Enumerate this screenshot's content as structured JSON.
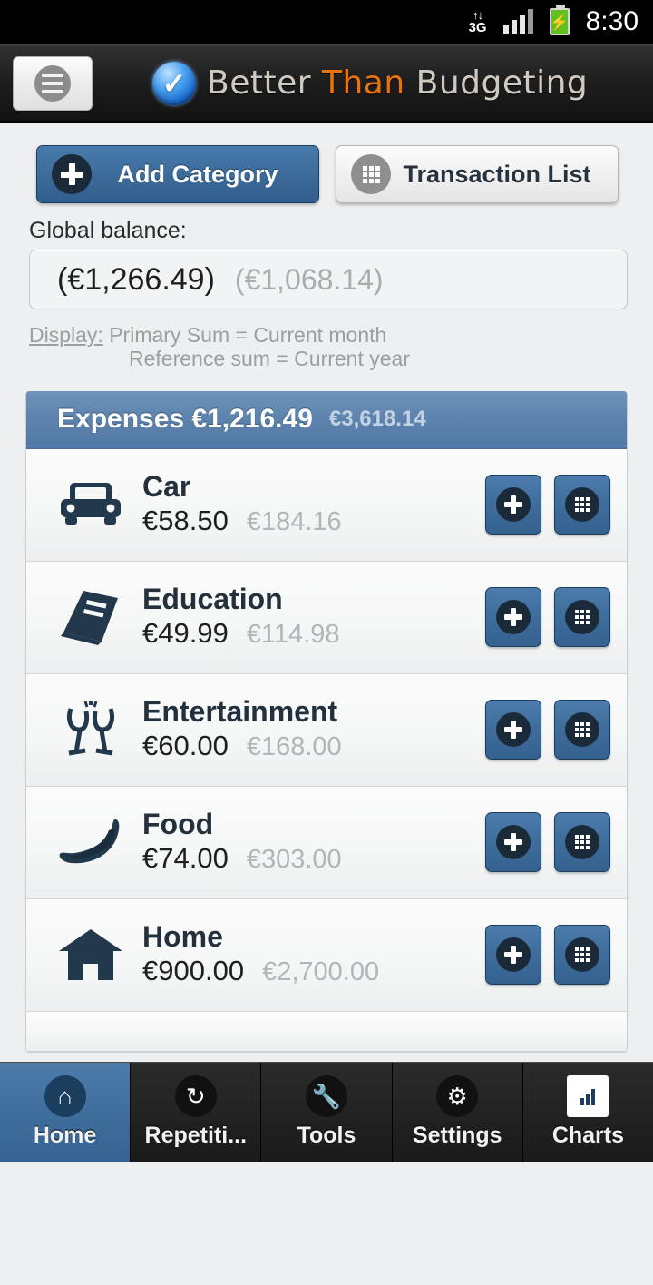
{
  "status_bar": {
    "network_label": "3G",
    "network_arrows": "↑↓",
    "time": "8:30",
    "signal_bars_total": 4,
    "signal_bars_filled": 3,
    "battery_state": "charging"
  },
  "app_bar": {
    "menu_icon": "hamburger-icon",
    "logo_icon": "check-circle-logo",
    "title_part_1": "Better",
    "title_part_2": "Than",
    "title_part_3": "Budgeting",
    "accent_color": "#e8720c"
  },
  "actions": {
    "add_category_label": "Add Category",
    "add_category_icon": "plus-icon",
    "transaction_list_label": "Transaction List",
    "transaction_list_icon": "grid-icon"
  },
  "balance": {
    "label": "Global balance:",
    "primary": "(€1,266.49)",
    "reference": "(€1,068.14)"
  },
  "display_note": {
    "link": "Display:",
    "line1": "Primary Sum = Current month",
    "line2": "Reference sum = Current year"
  },
  "expenses_panel": {
    "title": "Expenses €1,216.49",
    "reference": "€3,618.14",
    "header_color": "#5c83ad",
    "rows": [
      {
        "icon": "car-icon",
        "name": "Car",
        "primary": "€58.50",
        "reference": "€184.16"
      },
      {
        "icon": "book-icon",
        "name": "Education",
        "primary": "€49.99",
        "reference": "€114.98"
      },
      {
        "icon": "champagne-icon",
        "name": "Entertainment",
        "primary": "€60.00",
        "reference": "€168.00"
      },
      {
        "icon": "banana-icon",
        "name": "Food",
        "primary": "€74.00",
        "reference": "€303.00"
      },
      {
        "icon": "house-icon",
        "name": "Home",
        "primary": "€900.00",
        "reference": "€2,700.00"
      }
    ],
    "row_add_icon": "plus-icon",
    "row_list_icon": "grid-icon"
  },
  "bottom_nav": {
    "active_index": 0,
    "items": [
      {
        "label": "Home",
        "icon": "home-icon"
      },
      {
        "label": "Repetiti...",
        "icon": "refresh-icon"
      },
      {
        "label": "Tools",
        "icon": "wrench-icon"
      },
      {
        "label": "Settings",
        "icon": "gear-icon"
      },
      {
        "label": "Charts",
        "icon": "bar-chart-icon"
      }
    ]
  }
}
